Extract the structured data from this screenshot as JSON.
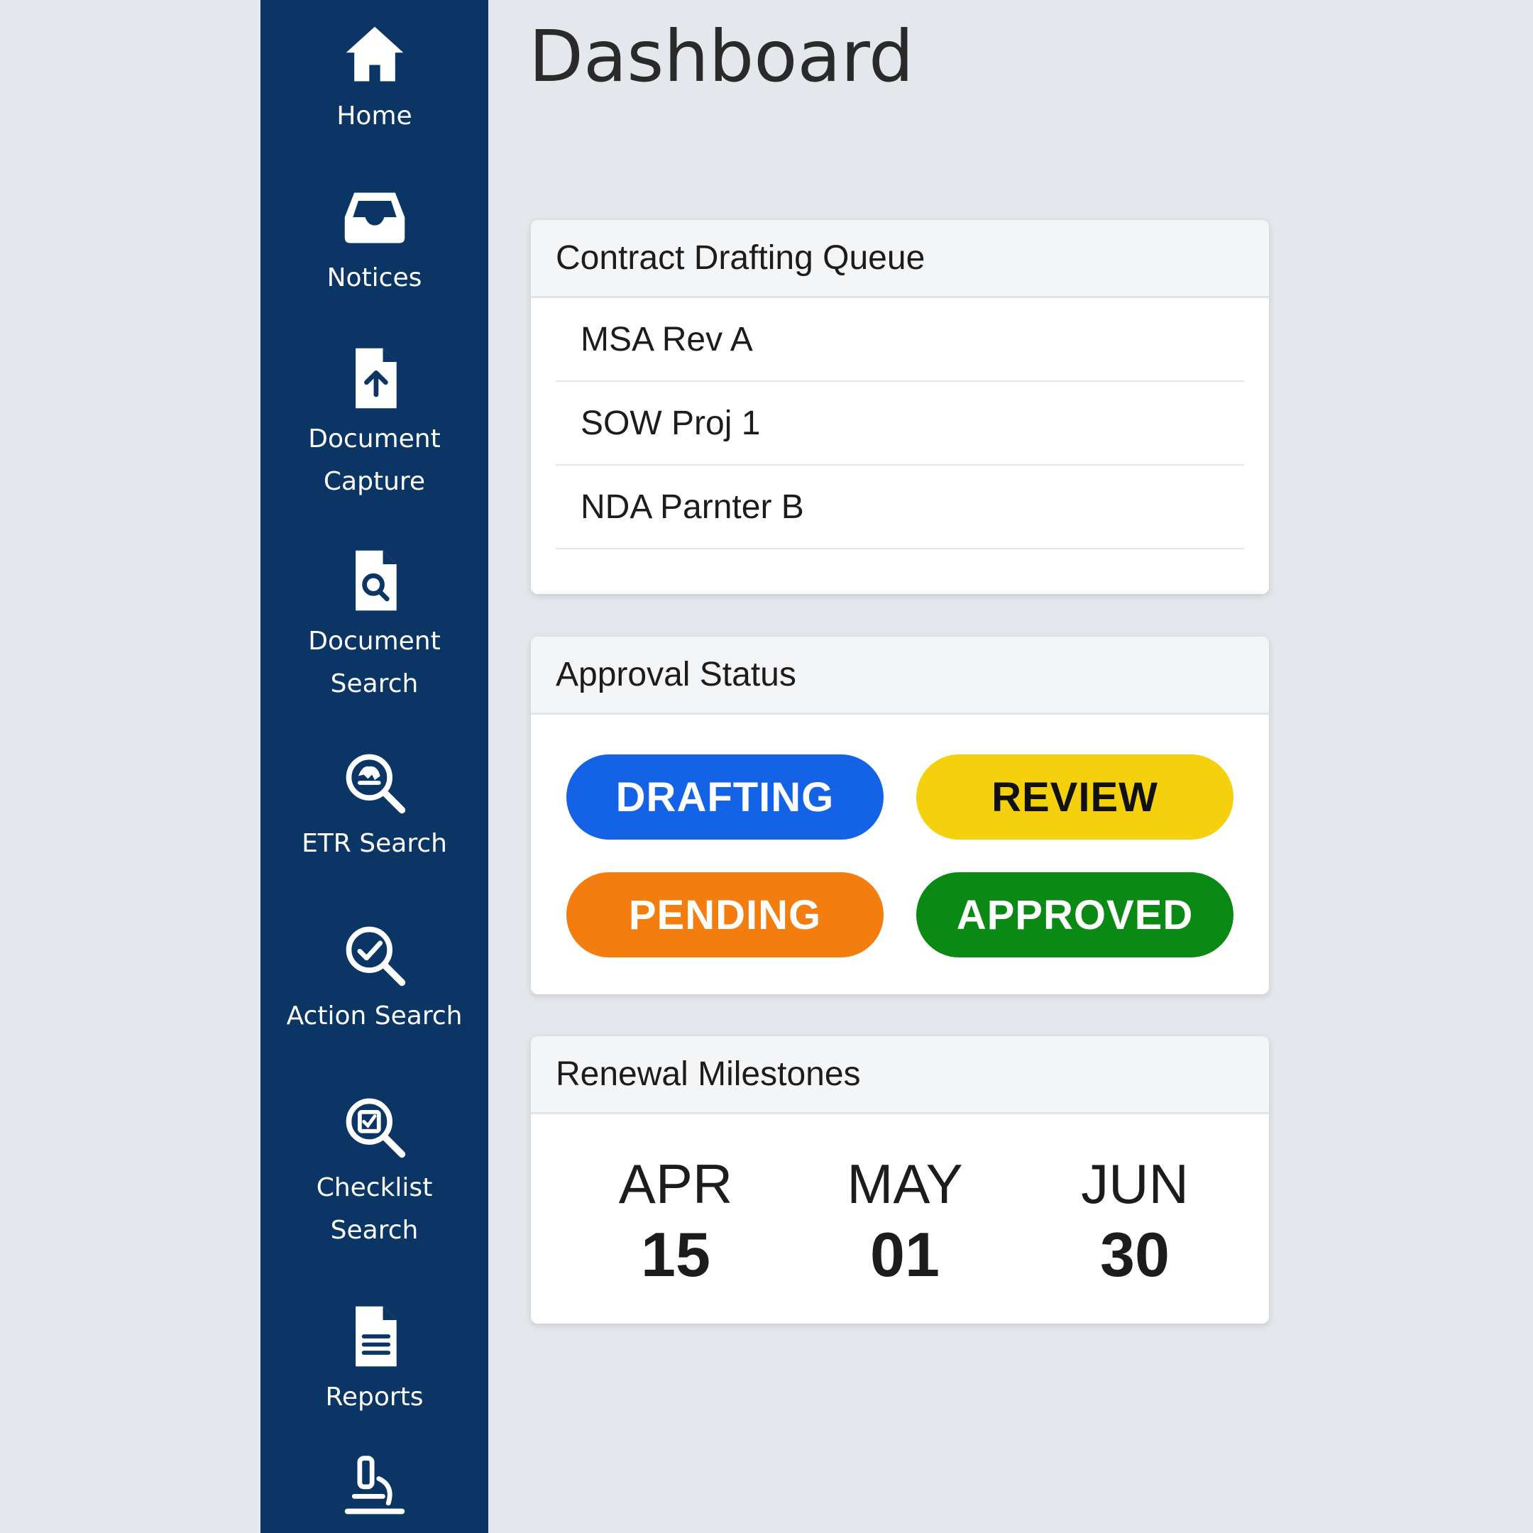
{
  "page": {
    "title": "Dashboard"
  },
  "sidebar": {
    "items": [
      {
        "label": "Home",
        "icon": "home-icon"
      },
      {
        "label": "Notices",
        "icon": "inbox-icon"
      },
      {
        "label": "Document\nCapture",
        "icon": "document-upload-icon"
      },
      {
        "label": "Document\nSearch",
        "icon": "document-search-icon"
      },
      {
        "label": "ETR Search",
        "icon": "etr-search-icon"
      },
      {
        "label": "Action Search",
        "icon": "action-search-icon"
      },
      {
        "label": "Checklist\nSearch",
        "icon": "checklist-search-icon"
      },
      {
        "label": "Reports",
        "icon": "report-icon"
      },
      {
        "icon": "microscope-icon"
      }
    ],
    "background": "#0b3565"
  },
  "contract_queue": {
    "title": "Contract Drafting Queue",
    "items": [
      "MSA Rev A",
      "SOW Proj 1",
      "NDA Parnter B"
    ]
  },
  "approval_status": {
    "title": "Approval Status",
    "badges": [
      {
        "label": "DRAFTING",
        "color": "#1463e6",
        "text_color": "#ffffff"
      },
      {
        "label": "REVIEW",
        "color": "#f4d00d",
        "text_color": "#111111"
      },
      {
        "label": "PENDING",
        "color": "#f47d0f",
        "text_color": "#ffffff"
      },
      {
        "label": "APPROVED",
        "color": "#0a8a14",
        "text_color": "#ffffff"
      }
    ]
  },
  "renewal_milestones": {
    "title": "Renewal Milestones",
    "dates": [
      {
        "month": "APR",
        "day": "15"
      },
      {
        "month": "MAY",
        "day": "01"
      },
      {
        "month": "JUN",
        "day": "30"
      }
    ]
  }
}
